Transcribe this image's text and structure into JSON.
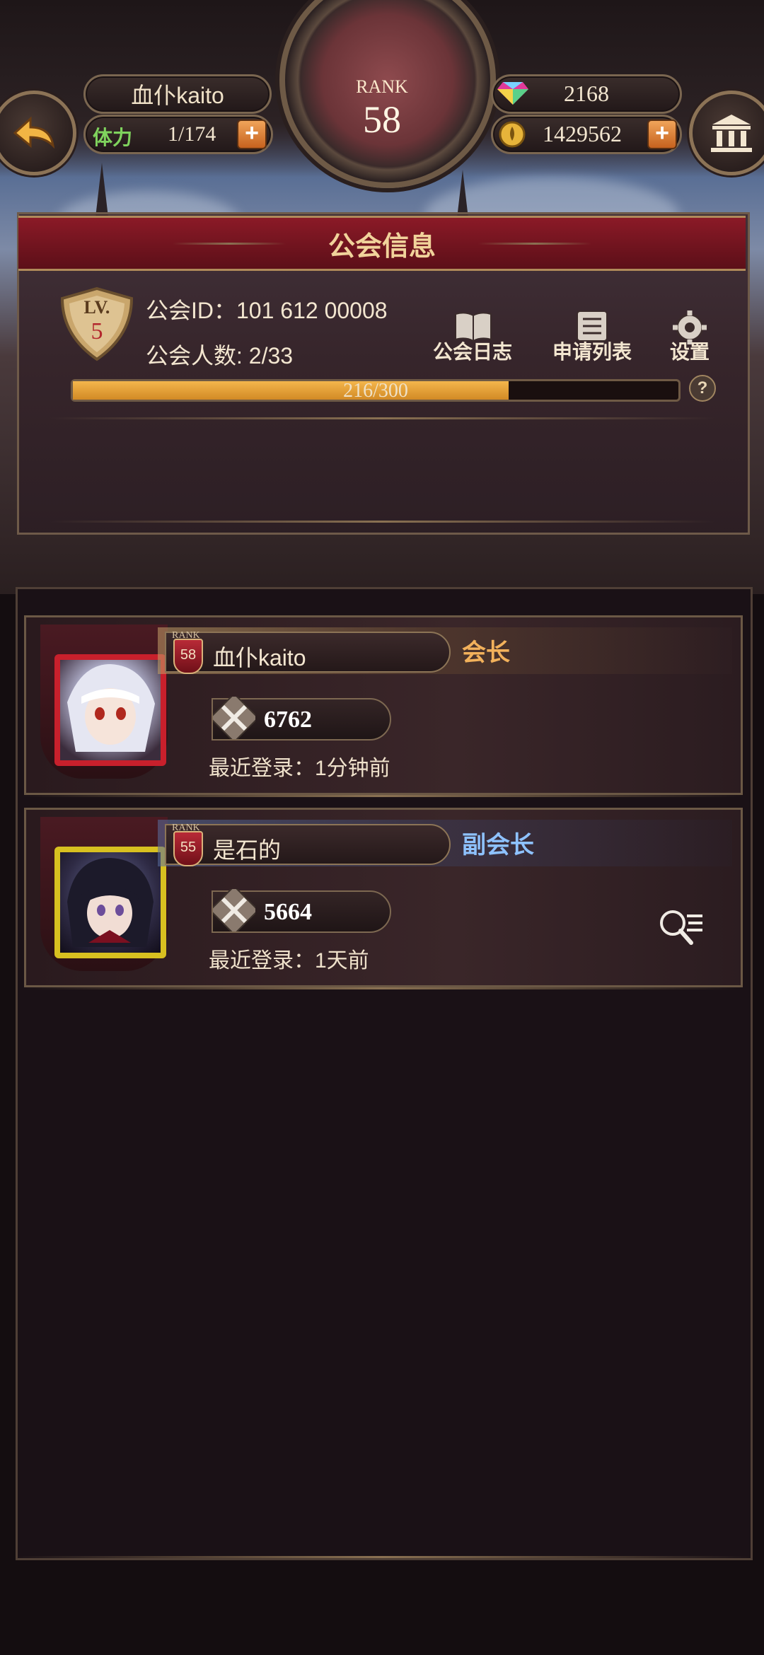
{
  "header": {
    "player_name": "血仆kaito",
    "stamina_label": "体力",
    "stamina_value": "1/174",
    "rank_label": "RANK",
    "rank_value": "58",
    "gems": "2168",
    "gold": "1429562",
    "plus": "+"
  },
  "guild": {
    "title": "公会信息",
    "level_label": "LV.",
    "level_value": "5",
    "id_text": "公会ID：101 612 00008",
    "members_text": "公会人数: 2/33",
    "actions": [
      {
        "label": "公会日志"
      },
      {
        "label": "申请列表"
      },
      {
        "label": "设置"
      }
    ],
    "progress_text": "216/300",
    "progress_fraction": 0.72,
    "help": "?"
  },
  "members": [
    {
      "rank_label": "RANK",
      "rank": "58",
      "name": "血仆kaito",
      "role": "会长",
      "power": "6762",
      "last_login": "最近登录：1分钟前",
      "frame_color": "#c8202c",
      "role_color": "#f2b15b"
    },
    {
      "rank_label": "RANK",
      "rank": "55",
      "name": "是石的",
      "role": "副会长",
      "power": "5664",
      "last_login": "最近登录：1天前",
      "frame_color": "#d8c020",
      "role_color": "#8ec2ff"
    }
  ],
  "icons": {
    "back": "back-arrow-icon",
    "bank": "bank-icon",
    "gem": "gem-icon",
    "gold": "gold-coin-icon",
    "power": "crossed-swords-icon",
    "inspect": "inspect-icon"
  }
}
